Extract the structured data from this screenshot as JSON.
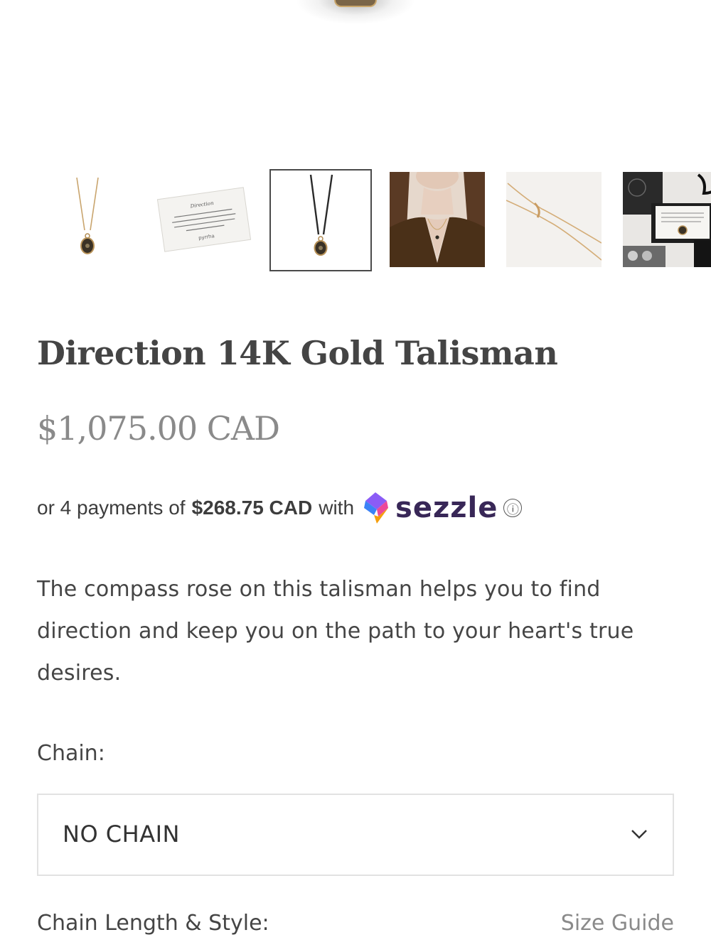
{
  "product": {
    "title": "Direction 14K Gold Talisman",
    "price": "$1,075.00 CAD"
  },
  "gallery": {
    "selected_index": 2,
    "thumbnails": [
      {
        "name": "pendant-on-gold-chain",
        "card_text": ""
      },
      {
        "name": "meaning-card",
        "card_text": {
          "heading": "Direction",
          "body": "The compass rose on this talisman helps you to find direction and keep you on the path to your heart's true desires.",
          "brand": "pyrrha"
        }
      },
      {
        "name": "pendant-on-black-cord",
        "card_text": ""
      },
      {
        "name": "model-wearing-pendant",
        "card_text": ""
      },
      {
        "name": "chain-detail",
        "card_text": ""
      },
      {
        "name": "packaging",
        "card_text": ""
      }
    ]
  },
  "installments": {
    "prefix": "or 4 payments of",
    "amount": "$268.75 CAD",
    "with": "with",
    "provider": "sezzle",
    "info_icon": "ⓘ"
  },
  "description": "The compass rose on this talisman helps you to find direction and keep you on the path to your heart's true desires.",
  "options": {
    "chain_label": "Chain:",
    "chain_value": "NO CHAIN",
    "length_label": "Chain Length & Style:",
    "size_guide": "Size Guide"
  },
  "colors": {
    "sezzle_purple": "#382757",
    "selected_border": "#4a4a4a",
    "price_gray": "#8a8a8a"
  }
}
